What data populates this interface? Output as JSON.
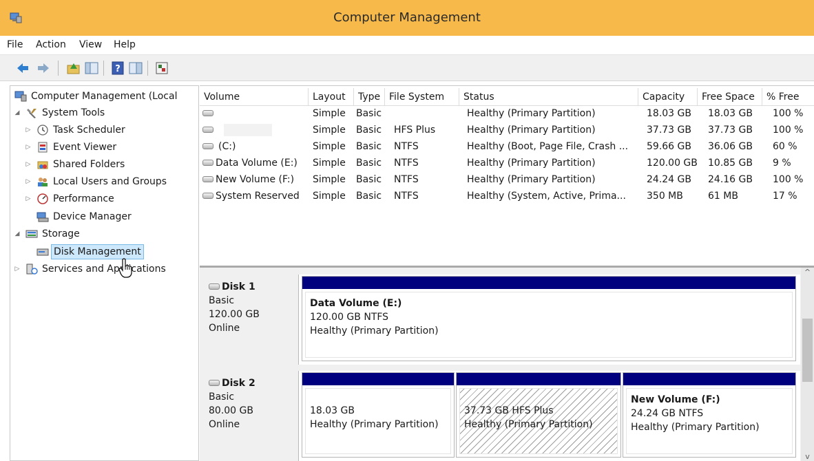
{
  "window": {
    "title": "Computer Management"
  },
  "menu": [
    "File",
    "Action",
    "View",
    "Help"
  ],
  "toolbar": {
    "buttons": [
      "back-arrow-icon",
      "forward-arrow-icon",
      "up-folder-icon",
      "show-hide-tree-icon",
      "help-icon",
      "console-view-icon",
      "properties-icon"
    ]
  },
  "tree": {
    "items": [
      {
        "label": "Computer Management (Local",
        "icon": "computer-management-icon",
        "toggle": "",
        "level": 0
      },
      {
        "label": "System Tools",
        "icon": "system-tools-icon",
        "toggle": "◢",
        "level": 1
      },
      {
        "label": "Task Scheduler",
        "icon": "clock-icon",
        "toggle": "▷",
        "level": 2
      },
      {
        "label": "Event Viewer",
        "icon": "event-viewer-icon",
        "toggle": "▷",
        "level": 2
      },
      {
        "label": "Shared Folders",
        "icon": "shared-folders-icon",
        "toggle": "▷",
        "level": 2
      },
      {
        "label": "Local Users and Groups",
        "icon": "users-icon",
        "toggle": "▷",
        "level": 2
      },
      {
        "label": "Performance",
        "icon": "performance-icon",
        "toggle": "▷",
        "level": 2
      },
      {
        "label": "Device Manager",
        "icon": "device-manager-icon",
        "toggle": "",
        "level": 2
      },
      {
        "label": "Storage",
        "icon": "storage-icon",
        "toggle": "◢",
        "level": 1
      },
      {
        "label": "Disk Management",
        "icon": "disk-management-icon",
        "toggle": "",
        "level": 2,
        "selected": true
      },
      {
        "label": "Services and Applications",
        "icon": "services-icon",
        "toggle": "▷",
        "level": 1
      }
    ]
  },
  "volumes": {
    "columns": [
      "Volume",
      "Layout",
      "Type",
      "File System",
      "Status",
      "Capacity",
      "Free Space",
      "% Free"
    ],
    "rows": [
      {
        "volume": "",
        "layout": "Simple",
        "type": "Basic",
        "fs": "",
        "status": "Healthy (Primary Partition)",
        "capacity": "18.03 GB",
        "free": "18.03 GB",
        "pct": "100 %"
      },
      {
        "volume": "",
        "layout": "Simple",
        "type": "Basic",
        "fs": "HFS Plus",
        "status": "Healthy (Primary Partition)",
        "capacity": "37.73 GB",
        "free": "37.73 GB",
        "pct": "100 %"
      },
      {
        "volume": "(C:)",
        "layout": "Simple",
        "type": "Basic",
        "fs": "NTFS",
        "status": "Healthy (Boot, Page File, Crash ...",
        "capacity": "59.66 GB",
        "free": "36.06 GB",
        "pct": "60 %"
      },
      {
        "volume": "Data Volume (E:)",
        "layout": "Simple",
        "type": "Basic",
        "fs": "NTFS",
        "status": "Healthy (Primary Partition)",
        "capacity": "120.00 GB",
        "free": "10.85 GB",
        "pct": "9 %"
      },
      {
        "volume": "New Volume (F:)",
        "layout": "Simple",
        "type": "Basic",
        "fs": "NTFS",
        "status": "Healthy (Primary Partition)",
        "capacity": "24.24 GB",
        "free": "24.16 GB",
        "pct": "100 %"
      },
      {
        "volume": "System Reserved",
        "layout": "Simple",
        "type": "Basic",
        "fs": "NTFS",
        "status": "Healthy (System, Active, Prima...",
        "capacity": "350 MB",
        "free": "61 MB",
        "pct": "17 %"
      }
    ]
  },
  "disks": [
    {
      "name": "Disk 1",
      "kind": "Basic",
      "size": "120.00 GB",
      "state": "Online",
      "partitions": [
        {
          "name": "Data Volume  (E:)",
          "size": "120.00 GB NTFS",
          "status": "Healthy (Primary Partition)",
          "hatched": false
        }
      ]
    },
    {
      "name": "Disk 2",
      "kind": "Basic",
      "size": "80.00 GB",
      "state": "Online",
      "partitions": [
        {
          "name": "",
          "size": "18.03 GB",
          "status": "Healthy (Primary Partition)",
          "hatched": false
        },
        {
          "name": "",
          "size": "37.73 GB HFS Plus",
          "status": "Healthy (Primary Partition)",
          "hatched": true
        },
        {
          "name": "New Volume  (F:)",
          "size": "24.24 GB NTFS",
          "status": "Healthy (Primary Partition)",
          "hatched": false
        }
      ]
    }
  ],
  "colors": {
    "titlebar": "#f6b94a",
    "partition_header": "#00007e",
    "selection": "#cde8fb"
  }
}
